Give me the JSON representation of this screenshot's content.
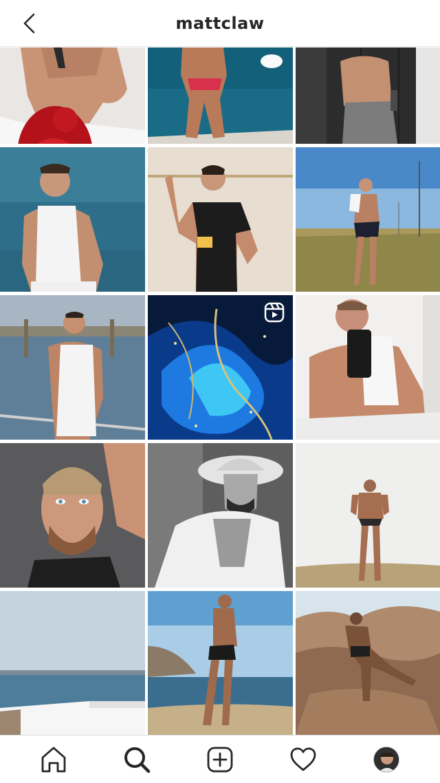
{
  "header": {
    "title": "mattclaw",
    "back_icon": "chevron-left-icon"
  },
  "grid": {
    "tiles": [
      {
        "id": 1,
        "subject": "shirtless-man-holding-red-roses",
        "reel": false
      },
      {
        "id": 2,
        "subject": "man-in-red-swimwear-by-sea",
        "reel": false
      },
      {
        "id": 3,
        "subject": "shirtless-man-gym-lockers",
        "reel": false
      },
      {
        "id": 4,
        "subject": "man-white-tank-top-sea",
        "reel": false
      },
      {
        "id": 5,
        "subject": "man-black-tshirt-holding-cards",
        "reel": false
      },
      {
        "id": 6,
        "subject": "man-in-grass-field-blue-sky",
        "reel": false
      },
      {
        "id": 7,
        "subject": "man-white-tank-top-harbor",
        "reel": false
      },
      {
        "id": 8,
        "subject": "abstract-blue-splash",
        "reel": true
      },
      {
        "id": 9,
        "subject": "mirror-selfie-white-tank",
        "reel": false
      },
      {
        "id": 10,
        "subject": "closeup-selfie-lying-on-sofa",
        "reel": false
      },
      {
        "id": 11,
        "subject": "man-wearing-hat-black-white",
        "reel": false
      },
      {
        "id": 12,
        "subject": "man-in-swimwear-white-wall",
        "reel": false
      },
      {
        "id": 13,
        "subject": "sea-view-white-terrace",
        "reel": false
      },
      {
        "id": 14,
        "subject": "man-on-beach-shore",
        "reel": false
      },
      {
        "id": 15,
        "subject": "man-sitting-on-rocks",
        "reel": false
      }
    ],
    "reel_icon": "reels-icon"
  },
  "bottom_nav": {
    "items": [
      {
        "name": "home",
        "icon": "home-icon"
      },
      {
        "name": "search",
        "icon": "search-icon",
        "active": true
      },
      {
        "name": "new-post",
        "icon": "add-post-icon"
      },
      {
        "name": "activity",
        "icon": "heart-icon"
      },
      {
        "name": "profile",
        "icon": "profile-avatar-icon"
      }
    ]
  },
  "colors": {
    "text": "#262626",
    "border": "#dbdbdb",
    "background": "#ffffff"
  }
}
